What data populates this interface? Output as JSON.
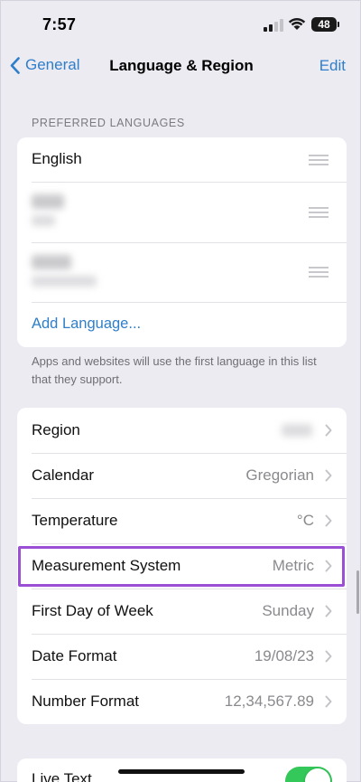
{
  "status_bar": {
    "time": "7:57",
    "battery": "48"
  },
  "nav": {
    "back_label": "General",
    "title": "Language & Region",
    "edit_label": "Edit"
  },
  "preferred_languages": {
    "header": "PREFERRED LANGUAGES",
    "items": [
      {
        "label": "English"
      }
    ],
    "add_language": "Add Language...",
    "footer": "Apps and websites will use the first language in this list that they support."
  },
  "settings": {
    "rows": [
      {
        "label": "Region",
        "value": ""
      },
      {
        "label": "Calendar",
        "value": "Gregorian"
      },
      {
        "label": "Temperature",
        "value": "°C"
      },
      {
        "label": "Measurement System",
        "value": "Metric"
      },
      {
        "label": "First Day of Week",
        "value": "Sunday"
      },
      {
        "label": "Date Format",
        "value": "19/08/23"
      },
      {
        "label": "Number Format",
        "value": "12,34,567.89"
      }
    ]
  },
  "live_text": {
    "label": "Live Text",
    "enabled": true
  },
  "colors": {
    "accent": "#2f7ec9",
    "highlight": "#9b4fd4",
    "toggle_on": "#34c759",
    "background": "#ecebf2"
  },
  "icons": [
    "chevron-left-icon",
    "chevron-right-icon",
    "drag-handle-icon",
    "signal-icon",
    "wifi-icon",
    "battery-icon"
  ]
}
